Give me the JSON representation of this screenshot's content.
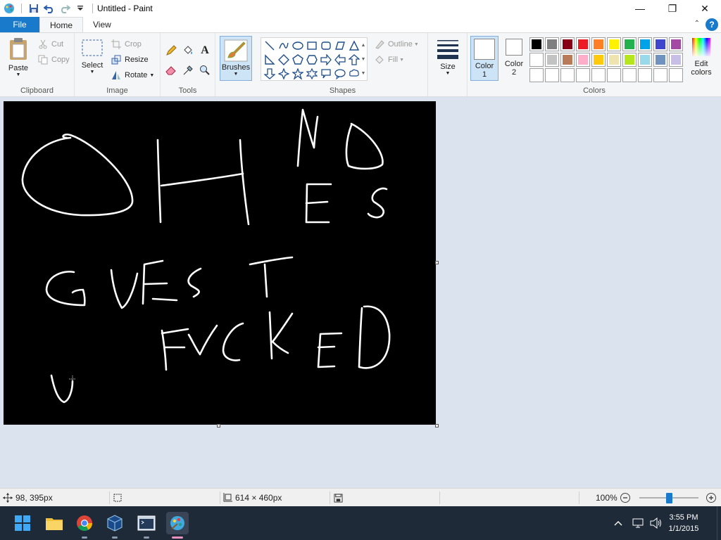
{
  "window": {
    "title": "Untitled - Paint",
    "controls": {
      "minimize": "—",
      "maximize": "❐",
      "close": "✕"
    }
  },
  "tabs": [
    {
      "label": "File"
    },
    {
      "label": "Home"
    },
    {
      "label": "View"
    }
  ],
  "help": "?",
  "ribbon": {
    "clipboard": {
      "paste": "Paste",
      "cut": "Cut",
      "copy": "Copy",
      "label": "Clipboard"
    },
    "image": {
      "select": "Select",
      "crop": "Crop",
      "resize": "Resize",
      "rotate": "Rotate",
      "label": "Image"
    },
    "tools": {
      "label": "Tools",
      "text_glyph": "A"
    },
    "brushes": {
      "label": "Brushes"
    },
    "shapes": {
      "outline": "Outline",
      "fill": "Fill",
      "label": "Shapes"
    },
    "size": {
      "label": "Size"
    },
    "colors": {
      "color1": "Color\n1",
      "color1_line1": "Color",
      "color1_line2": "1",
      "color2_line1": "Color",
      "color2_line2": "2",
      "edit_line1": "Edit",
      "edit_line2": "colors",
      "label": "Colors",
      "palette_row1": [
        "#000000",
        "#7f7f7f",
        "#880015",
        "#ed1c24",
        "#ff7f27",
        "#fff200",
        "#22b14c",
        "#00a2e8",
        "#3f48cc",
        "#a349a4"
      ],
      "palette_row2": [
        "#ffffff",
        "#c3c3c3",
        "#b97a57",
        "#ffaec9",
        "#ffc90e",
        "#efe4b0",
        "#b5e61d",
        "#99d9ea",
        "#7092be",
        "#c8bfe7"
      ]
    }
  },
  "status": {
    "cursor_pos": "98, 395px",
    "canvas_size": "614 × 460px",
    "zoom": "100%",
    "zoom_level": 0.5
  },
  "taskbar": {
    "time": "3:55 PM",
    "date": "1/1/2015"
  }
}
